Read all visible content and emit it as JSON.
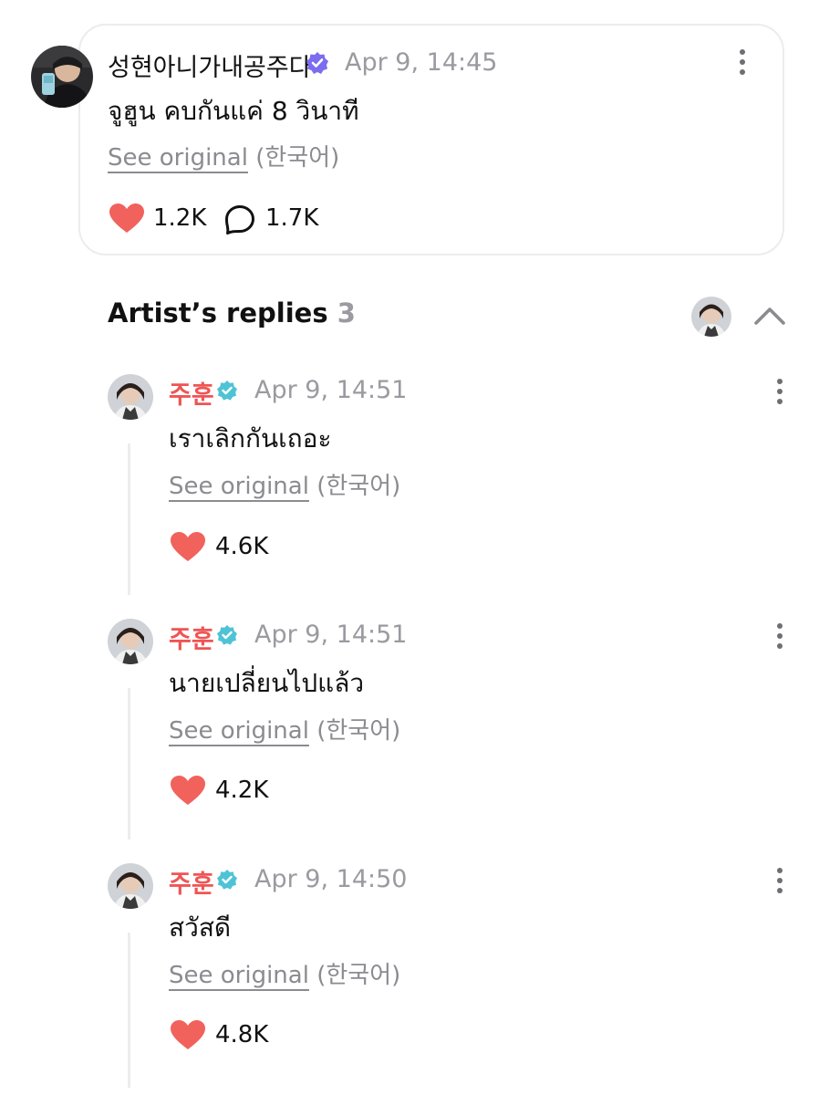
{
  "post": {
    "author": "성현아니가내공주다",
    "time": "Apr 9, 14:45",
    "text": "จูฮูน คบกันแค่ 8 วินาที",
    "see_original": "See original",
    "language": "(한국어)",
    "likes": "1.2K",
    "comments": "1.7K"
  },
  "replies_section": {
    "title": "Artist’s replies",
    "count": "3"
  },
  "replies": [
    {
      "author": "주훈",
      "time": "Apr 9, 14:51",
      "text": "เราเลิกกันเถอะ",
      "see_original": "See original",
      "language": "(한국어)",
      "likes": "4.6K"
    },
    {
      "author": "주훈",
      "time": "Apr 9, 14:51",
      "text": "นายเปลี่ยนไปแล้ว",
      "see_original": "See original",
      "language": "(한국어)",
      "likes": "4.2K"
    },
    {
      "author": "주훈",
      "time": "Apr 9, 14:50",
      "text": "สวัสดี",
      "see_original": "See original",
      "language": "(한국어)",
      "likes": "4.8K"
    }
  ],
  "colors": {
    "heart": "#f1625c",
    "artist_name": "#f05454",
    "verified_user": "#7b6cf0",
    "verified_artist": "#4fc3d6",
    "muted": "#9a9aa0"
  },
  "icons": {
    "verified_user": "verified-badge-icon",
    "verified_artist": "verified-check-icon",
    "like": "heart-icon",
    "comment": "speech-bubble-icon",
    "more": "more-vertical-icon",
    "collapse": "chevron-up-icon"
  }
}
